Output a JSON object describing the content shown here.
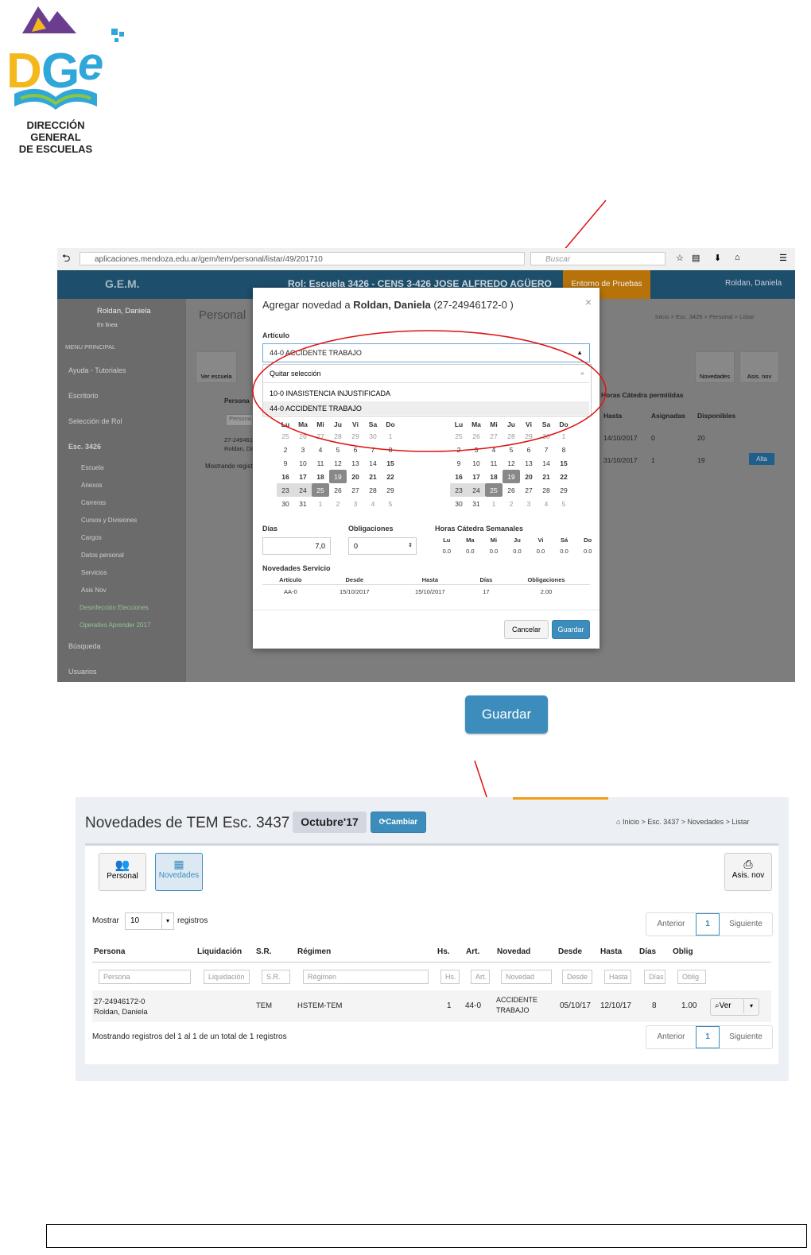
{
  "logo": {
    "line1": "DIRECCIÓN GENERAL",
    "line2": "DE ESCUELAS"
  },
  "shot1": {
    "url": "aplicaciones.mendoza.edu.ar/gem/tem/personal/listar/49/201710",
    "search_placeholder": "Buscar",
    "app": "G.E.M.",
    "role": "Rol: Escuela 3426 - CENS 3-426 JOSE ALFREDO AGÜERO",
    "env": "Entorno de Pruebas",
    "user": "Roldan, Daniela",
    "online": "En línea",
    "menu_header": "MENU PRINCIPAL",
    "menu": [
      "Ayuda - Tutoriales",
      "Escritorio",
      "Selección de Rol",
      "Esc. 3426",
      "Escuela",
      "Anexos",
      "Carreras",
      "Cursos y Divisiones",
      "Cargos",
      "Datos personal",
      "Servicios",
      "Asis Nov",
      "Desinfección Elecciones",
      "Operativo Aprender 2017",
      "Búsqueda",
      "Usuarios"
    ],
    "page_title": "Personal",
    "crumbs": "Inicio > Esc. 3426 > Personal > Listar",
    "ver_escuela": "Ver escuela",
    "novedades": "Novedades",
    "asis_nov": "Asis. nov",
    "persona_col": "Persona",
    "persona_placeholder": "Persona",
    "person_cuil": "27-24946172-0",
    "person_name": "Roldan, Daniela",
    "mostrando": "Mostrando registros",
    "horas_cat": "Horas Cátedra permitidas",
    "bg_cols": [
      "Hasta",
      "Asignadas",
      "Disponibles"
    ],
    "bg_rows": [
      [
        "14/10/2017",
        "0",
        "20"
      ],
      [
        "31/10/2017",
        "1",
        "19"
      ]
    ],
    "alta": "Alta",
    "modal": {
      "title_prefix": "Agregar novedad a ",
      "title_name": "Roldan, Daniela",
      "title_suffix": " (27-24946172-0 )",
      "articulo_label": "Artículo",
      "articulo_value": "44-0 ACCIDENTE TRABAJO",
      "quitar": "Quitar selección",
      "opt1": "10-0 INASISTENCIA INJUSTIFICADA",
      "opt2": "44-0 ACCIDENTE TRABAJO",
      "dias_label": "Días",
      "dias_value": "7,0",
      "oblig_label": "Obligaciones",
      "oblig_value": "0",
      "horas_label": "Horas Cátedra Semanales",
      "horas_days": [
        "Lu",
        "Ma",
        "Mi",
        "Ju",
        "Vi",
        "Sá",
        "Do"
      ],
      "horas_values": [
        "0.0",
        "0.0",
        "0.0",
        "0.0",
        "0.0",
        "0.0",
        "0.0"
      ],
      "nov_label": "Novedades Servicio",
      "nov_cols": [
        "Artículo",
        "Desde",
        "Hasta",
        "Días",
        "Obligaciones"
      ],
      "nov_row": [
        "AA-0",
        "15/10/2017",
        "15/10/2017",
        "17",
        "2.00"
      ],
      "cancel": "Cancelar",
      "save": "Guardar"
    }
  },
  "guardar_big": "Guardar",
  "shot2": {
    "title": "Novedades de TEM Esc. 3437 -",
    "month": "Octubre'17",
    "cambiar": "Cambiar",
    "crumbs": [
      "Inicio",
      "Esc. 3437",
      "Novedades",
      "Listar"
    ],
    "btn_personal": "Personal",
    "btn_novedades": "Novedades",
    "btn_asis": "Asis. nov",
    "mostrar": "Mostrar",
    "mostrar_value": "10",
    "registros": "registros",
    "anterior": "Anterior",
    "page": "1",
    "siguiente": "Siguiente",
    "cols": [
      "Persona",
      "Liquidación",
      "S.R.",
      "Régimen",
      "Hs.",
      "Art.",
      "Novedad",
      "Desde",
      "Hasta",
      "Días",
      "Oblig"
    ],
    "row": {
      "cuil": "27-24946172-0",
      "name": "Roldan, Daniela",
      "sr": "TEM",
      "regimen": "HSTEM-TEM",
      "hs": "1",
      "art": "44-0",
      "novedad1": "ACCIDENTE",
      "novedad2": "TRABAJO",
      "desde": "05/10/17",
      "hasta": "12/10/17",
      "dias": "8",
      "oblig": "1.00",
      "ver": "Ver"
    },
    "footer": "Mostrando registros del 1 al 1 de un total de 1 registros"
  }
}
